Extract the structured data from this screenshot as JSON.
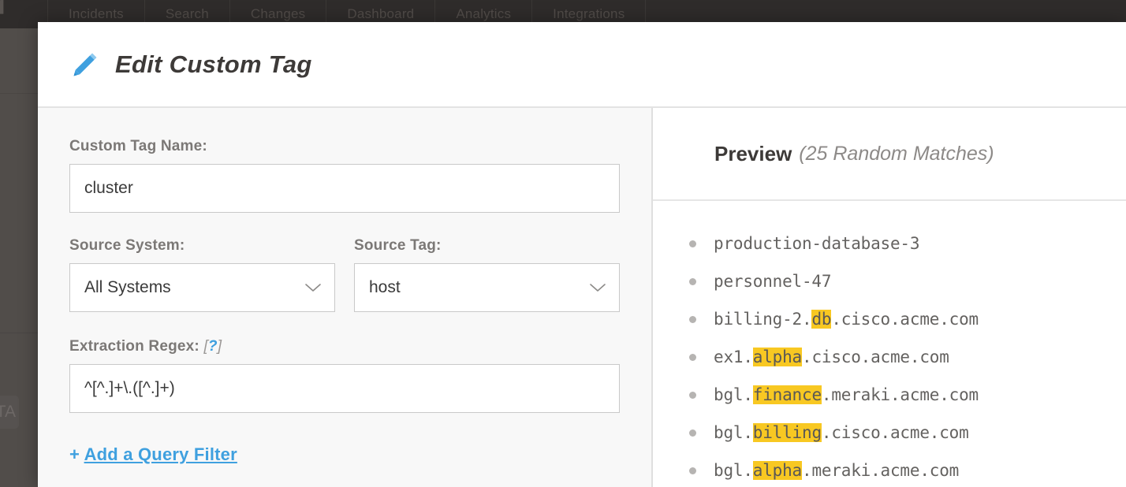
{
  "background": {
    "logo_glyph": "◢",
    "nav_tabs": [
      {
        "label": "Incidents"
      },
      {
        "label": "Search"
      },
      {
        "label": "Changes"
      },
      {
        "label": "Dashboard"
      },
      {
        "label": "Analytics"
      },
      {
        "label": "Integrations"
      }
    ],
    "sidebar_chip_label": "TA"
  },
  "modal": {
    "icon": "pencil-icon",
    "title": "Edit Custom Tag"
  },
  "form": {
    "tag_name": {
      "label": "Custom Tag Name:",
      "value": "cluster",
      "placeholder": ""
    },
    "source_system": {
      "label": "Source System:",
      "value": "All Systems",
      "options": [
        "All Systems"
      ]
    },
    "source_tag": {
      "label": "Source Tag:",
      "value": "host",
      "options": [
        "host"
      ]
    },
    "regex": {
      "label": "Extraction Regex:",
      "hint_open": "[",
      "hint_mark": "?",
      "hint_close": "]",
      "value": "^[^.]+\\.([^.]+)",
      "placeholder": ""
    },
    "add_filter": {
      "plus": "+",
      "label": "Add a Query Filter"
    }
  },
  "preview": {
    "title": "Preview",
    "subtitle": "(25 Random Matches)",
    "match_count": 25,
    "items": [
      {
        "before": "production-database-3",
        "match": "",
        "after": ""
      },
      {
        "before": "personnel-47",
        "match": "",
        "after": ""
      },
      {
        "before": "billing-2.",
        "match": "db",
        "after": ".cisco.acme.com"
      },
      {
        "before": "ex1.",
        "match": "alpha",
        "after": ".cisco.acme.com"
      },
      {
        "before": "bgl.",
        "match": "finance",
        "after": ".meraki.acme.com"
      },
      {
        "before": "bgl.",
        "match": "billing",
        "after": ".cisco.acme.com"
      },
      {
        "before": "bgl.",
        "match": "alpha",
        "after": ".meraki.acme.com"
      }
    ]
  },
  "colors": {
    "accent_blue": "#3fa0df",
    "highlight_yellow": "#f8c822",
    "nav_background": "#2f2c2b",
    "backdrop": "#4b4846",
    "form_background": "#f8f8f8"
  }
}
